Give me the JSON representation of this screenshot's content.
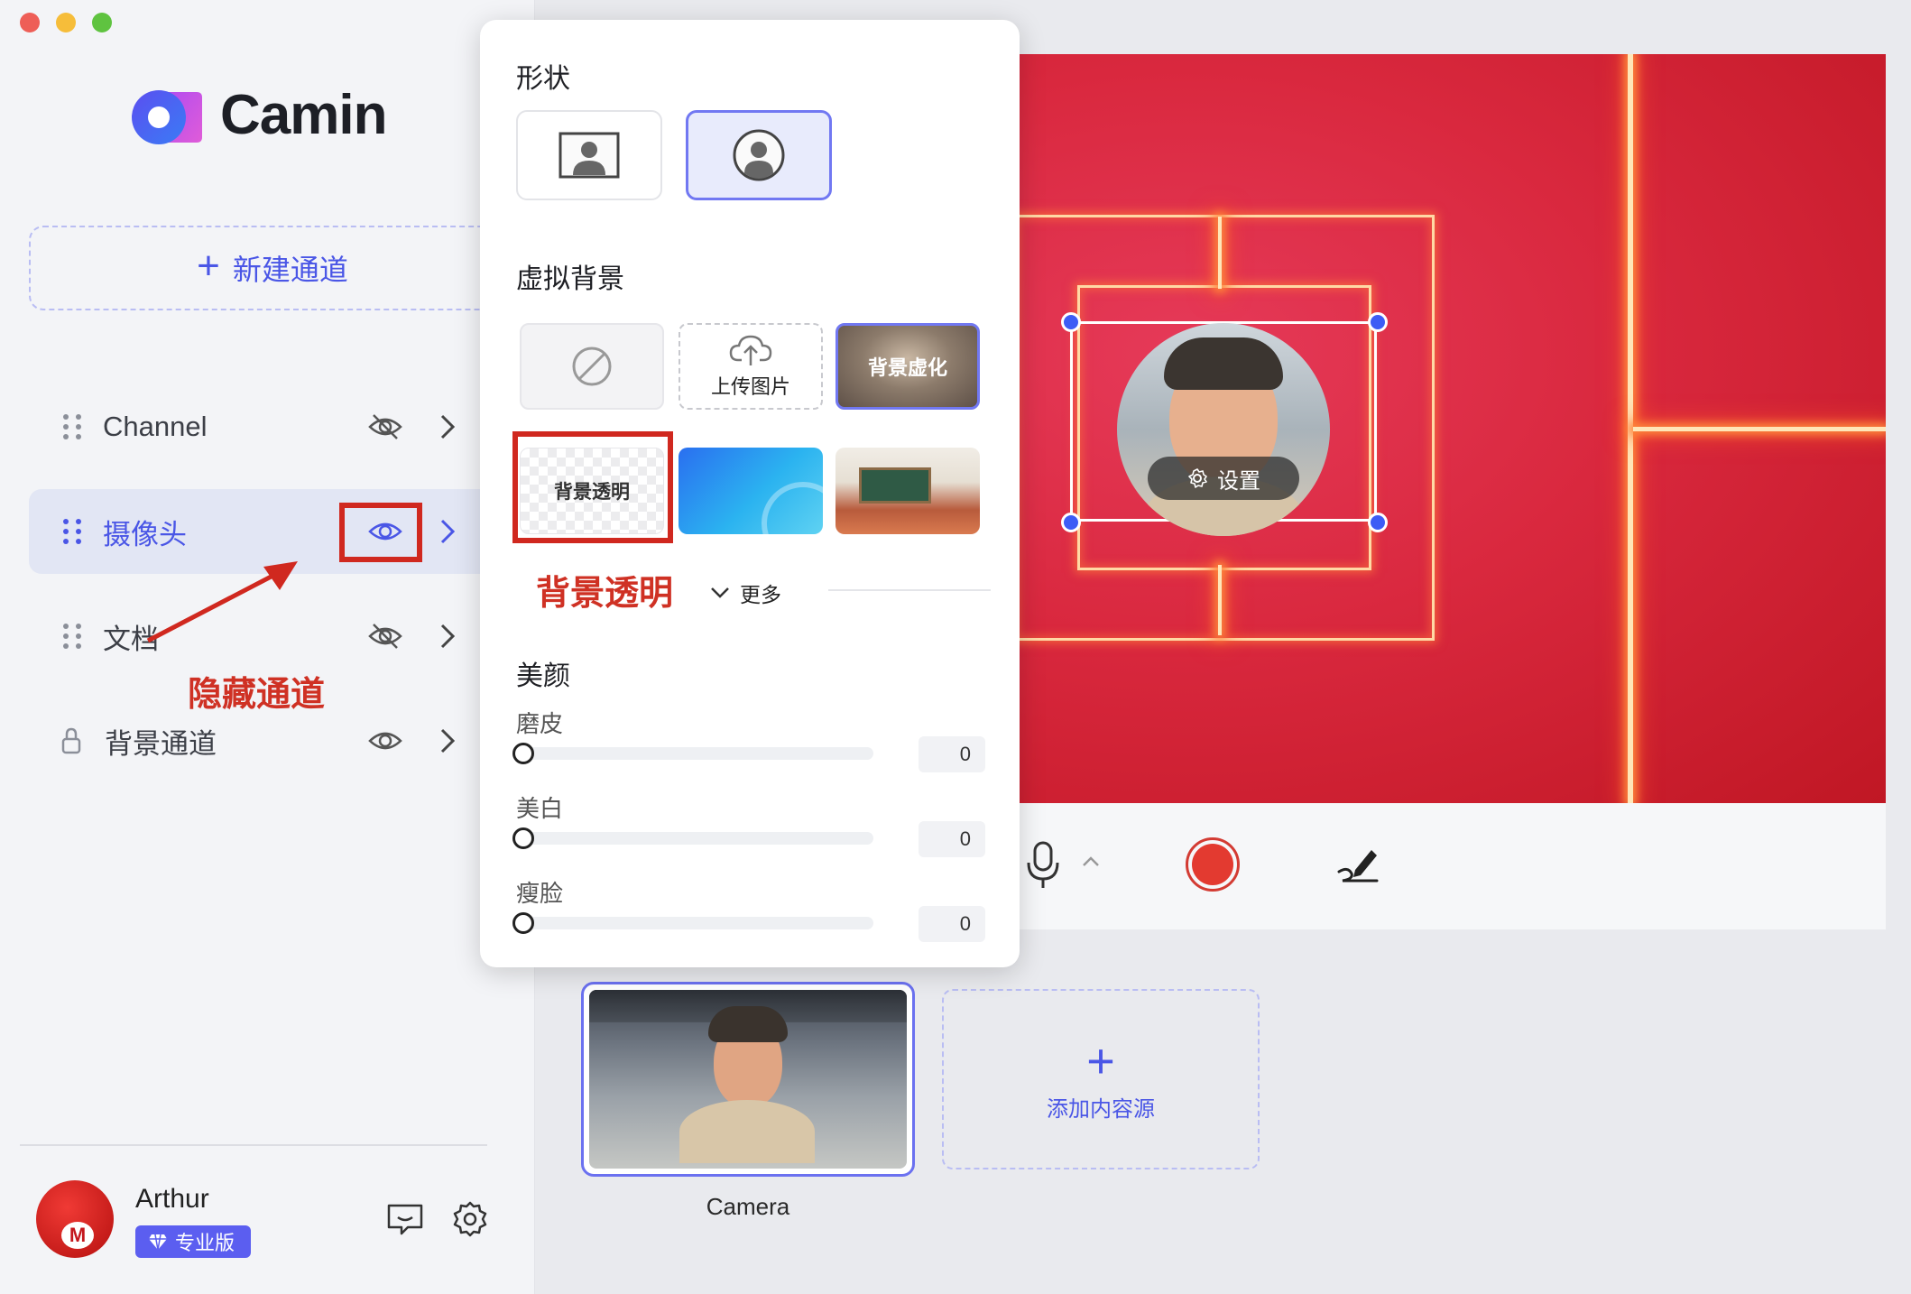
{
  "window": {
    "traffic_lights": [
      "#ee5e57",
      "#f6bd3a",
      "#5fc340"
    ]
  },
  "brand": {
    "name": "Camin",
    "accent": "#4a56e6"
  },
  "sidebar": {
    "new_channel_label": "新建通道",
    "channels": [
      {
        "label": "Channel",
        "visible": false,
        "locked": false,
        "active": false
      },
      {
        "label": "摄像头",
        "visible": true,
        "locked": false,
        "active": true
      },
      {
        "label": "文档",
        "visible": false,
        "locked": false,
        "active": false
      },
      {
        "label": "背景通道",
        "visible": true,
        "locked": true,
        "active": false
      }
    ],
    "annotation_hide_channel": "隐藏通道"
  },
  "user": {
    "name": "Arthur",
    "badge": "专业版",
    "avatar_letter": "M"
  },
  "popup": {
    "shape_title": "形状",
    "virtual_bg_title": "虚拟背景",
    "bg_upload_label": "上传图片",
    "bg_blur_label": "背景虚化",
    "bg_transparent_label": "背景透明",
    "annotation_transparent": "背景透明",
    "more_label": "更多",
    "beauty_title": "美颜",
    "sliders": [
      {
        "label": "磨皮",
        "value": "0"
      },
      {
        "label": "美白",
        "value": "0"
      },
      {
        "label": "瘦脸",
        "value": "0"
      }
    ]
  },
  "stage": {
    "settings_label": "设置"
  },
  "sources": {
    "camera_label": "Camera",
    "add_label": "添加内容源"
  }
}
